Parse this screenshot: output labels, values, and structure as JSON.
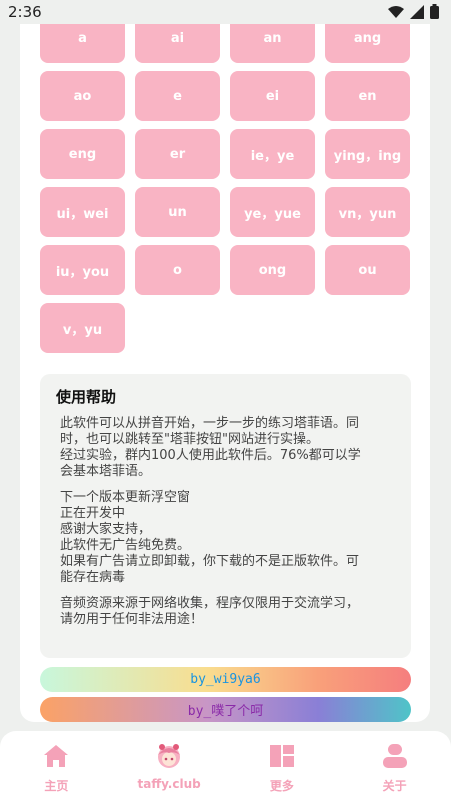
{
  "status_bar": {
    "time": "2:36"
  },
  "keys": [
    "a",
    "ai",
    "an",
    "ang",
    "ao",
    "e",
    "ei",
    "en",
    "eng",
    "er",
    "ie，ye",
    "ying，ing",
    "ui，wei",
    "un",
    "ye，yue",
    "vn，yun",
    "iu，you",
    "o",
    "ong",
    "ou",
    "v，yu"
  ],
  "help": {
    "title": "使用帮助",
    "paragraphs": [
      [
        "此软件可以从拼音开始，一步一步的练习塔菲语。同",
        "时，也可以跳转至\"塔菲按钮\"网站进行实操。",
        "经过实验，群内100人使用此软件后。76%都可以学",
        "会基本塔菲语。"
      ],
      [
        "下一个版本更新浮空窗",
        "正在开发中",
        "感谢大家支持，",
        "此软件无广告纯免费。",
        "如果有广告请立即卸载，你下载的不是正版软件。可",
        "能存在病毒"
      ],
      [
        "音频资源来源于网络收集，程序仅限用于交流学习，",
        "请勿用于任何非法用途！"
      ]
    ]
  },
  "banners": {
    "first": "by_wi9ya6",
    "second": "by_噗了个呵"
  },
  "nav": [
    {
      "label": "主页",
      "icon": "home-icon"
    },
    {
      "label": "taffy.club",
      "icon": "avatar-icon"
    },
    {
      "label": "更多",
      "icon": "dashboard-icon"
    },
    {
      "label": "关于",
      "icon": "person-icon"
    }
  ],
  "colors": {
    "key_bg": "#f9b4c4",
    "nav_label": "#f4a2b8",
    "help_bg": "#f2f3f1"
  }
}
